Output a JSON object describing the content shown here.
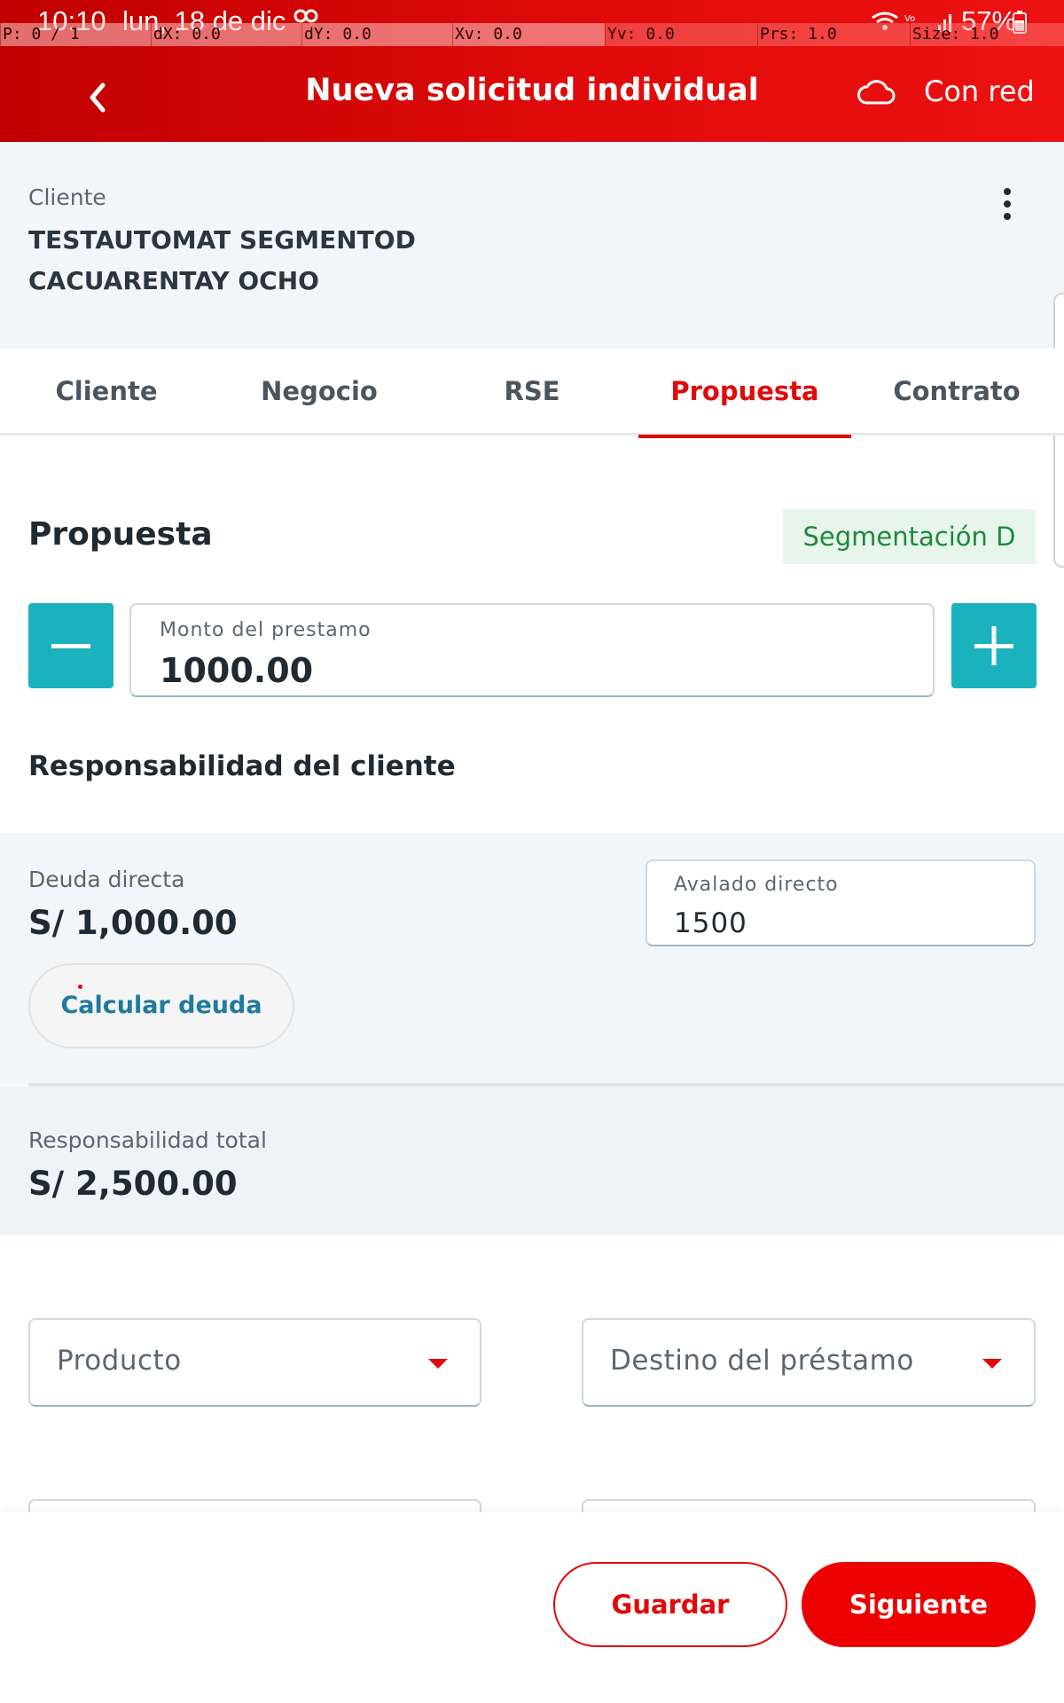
{
  "status_bar": {
    "time": "10:10",
    "date": "lun, 18 de dic",
    "battery": "57%"
  },
  "debug_overlay": [
    "P: 0 / 1",
    "dX: 0.0",
    "dY: 0.0",
    "Xv: 0.0",
    "Yv: 0.0",
    "Prs: 1.0",
    "Size: 1.0"
  ],
  "header": {
    "title": "Nueva solicitud individual",
    "network_status": "Con red"
  },
  "client": {
    "label": "Cliente",
    "name_line1": "TESTAUTOMAT SEGMENTOD",
    "name_line2": "CACUARENTAY OCHO"
  },
  "tabs": [
    {
      "label": "Cliente"
    },
    {
      "label": "Negocio"
    },
    {
      "label": "RSE"
    },
    {
      "label": "Propuesta",
      "active": true
    },
    {
      "label": "Contrato"
    }
  ],
  "proposal": {
    "title": "Propuesta",
    "segment_badge": "Segmentación D",
    "loan_amount": {
      "label": "Monto del prestamo",
      "value": "1000.00"
    }
  },
  "responsibility": {
    "title": "Responsabilidad del cliente",
    "direct_debt_label": "Deuda directa",
    "direct_debt_value": "S/ 1,000.00",
    "calc_button": "Calcular deuda",
    "guaranteed": {
      "label": "Avalado directo",
      "value": "1500"
    },
    "total_label": "Responsabilidad total",
    "total_value": "S/ 2,500.00"
  },
  "selects": {
    "product": "Producto",
    "loan_purpose": "Destino del préstamo"
  },
  "footer": {
    "save": "Guardar",
    "next": "Siguiente"
  },
  "colors": {
    "brand_red": "#e00a0a",
    "accent_teal": "#1ab3bd",
    "badge_green": "#1d8a3a"
  }
}
